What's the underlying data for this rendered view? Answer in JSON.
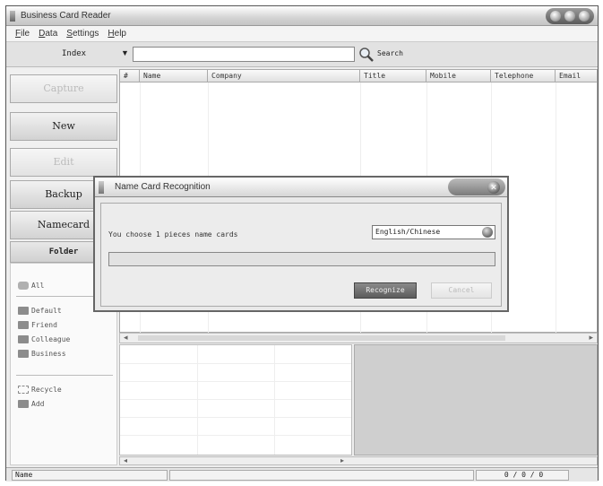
{
  "window": {
    "title": "Business Card Reader"
  },
  "menu": [
    {
      "label": "File",
      "u": "F",
      "rest": "ile"
    },
    {
      "label": "Data",
      "u": "D",
      "rest": "ata"
    },
    {
      "label": "Settings",
      "u": "S",
      "rest": "ettings"
    },
    {
      "label": "Help",
      "u": "H",
      "rest": "elp"
    }
  ],
  "search": {
    "index_label": "Index",
    "value": "",
    "button_label": "Search"
  },
  "sidebar": {
    "capture": "Capture",
    "new": "New",
    "edit": "Edit",
    "backup": "Backup",
    "namecard": "Namecard",
    "folder_header": "Folder",
    "folders": {
      "all": "All",
      "default": "Default",
      "friend": "Friend",
      "colleague": "Colleague",
      "business": "Business",
      "recycle": "Recycle",
      "add": "Add"
    }
  },
  "table": {
    "columns": [
      "#",
      "Name",
      "Company",
      "Title",
      "Mobile",
      "Telephone",
      "Email"
    ]
  },
  "statusbar": {
    "left": "Name",
    "counter": "0 / 0 / 0"
  },
  "dialog": {
    "title": "Name Card Recognition",
    "message": "You choose 1 pieces name cards",
    "language": "English/Chinese",
    "progress": 0,
    "recognize_label": "Recognize",
    "cancel_label": "Cancel"
  }
}
